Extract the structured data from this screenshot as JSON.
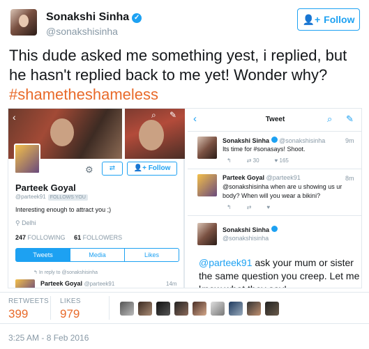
{
  "author": {
    "name": "Sonakshi Sinha",
    "handle": "@sonakshisinha",
    "verified_icon": "verified-badge-icon"
  },
  "follow_button": {
    "label": "Follow"
  },
  "tweet": {
    "text": "This dude asked me something yest, i replied, but he hasn't replied back to me yet! Wonder why? ",
    "hashtag": "#shametheshameless",
    "hashtag_color": "#e86a2a"
  },
  "embedded_image": {
    "profile": {
      "name": "Parteek Goyal",
      "handle": "@parteek91",
      "follows_you": "FOLLOWS YOU",
      "bio": "Interesting enough to attract you ;)",
      "location": "Delhi",
      "following_count": "247",
      "following_label": "FOLLOWING",
      "followers_count": "61",
      "followers_label": "FOLLOWERS",
      "follow_label": "Follow",
      "tabs": [
        "Tweets",
        "Media",
        "Likes"
      ],
      "reply_note": "In reply to @sonakshisinha",
      "row_name": "Parteek Goyal",
      "row_handle": "@parteek91",
      "row_time": "14m"
    },
    "thread": {
      "header_title": "Tweet",
      "tweet1": {
        "name": "Sonakshi Sinha",
        "handle": "@sonakshisinha",
        "time": "9m",
        "text": "Its time for #sonasays! Shoot.",
        "retweets": "30",
        "likes": "165"
      },
      "tweet2": {
        "name": "Parteek Goyal",
        "handle": "@parteek91",
        "time": "8m",
        "text": "@sonakshisinha when are u showing us ur body? When will you wear a bikini?"
      },
      "tweet3": {
        "name": "Sonakshi Sinha",
        "handle": "@sonakshisinha",
        "mention": "@parteek91",
        "text": " ask your mum or sister the same question you creep. Let me know what they say!"
      }
    }
  },
  "stats": {
    "retweets_label": "RETWEETS",
    "retweets_value": "399",
    "likes_label": "LIKES",
    "likes_value": "979"
  },
  "timestamp": "3:25 AM - 8 Feb 2016"
}
